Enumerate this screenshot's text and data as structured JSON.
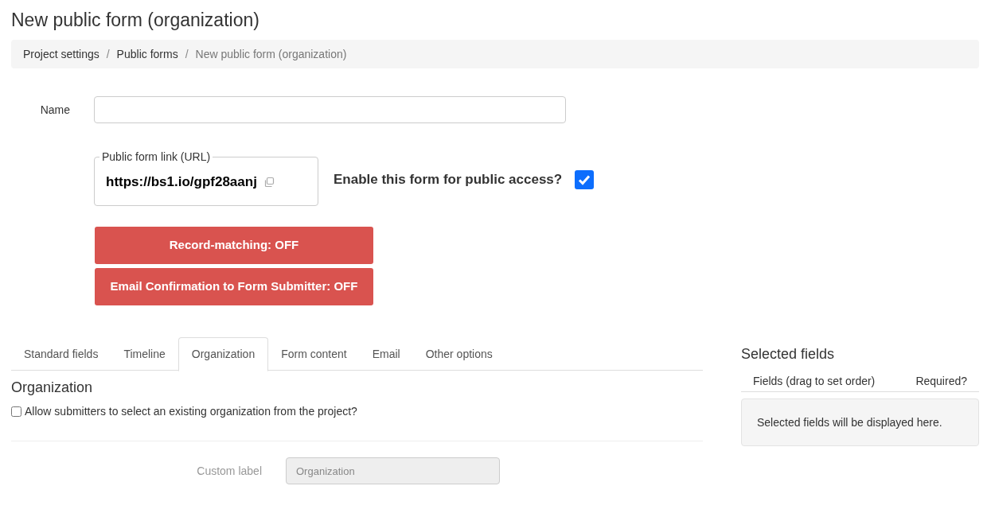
{
  "page_title": "New public form (organization)",
  "breadcrumb_separator": "/",
  "breadcrumb": [
    {
      "label": "Project settings",
      "link": true
    },
    {
      "label": "Public forms",
      "link": true
    },
    {
      "label": "New public form (organization)",
      "link": false
    }
  ],
  "name_field": {
    "label": "Name"
  },
  "public_link": {
    "legend": "Public form link (URL)",
    "url": "https://bs1.io/gpf28aanj"
  },
  "public_access": {
    "label": "Enable this form for public access?",
    "checked": true
  },
  "toggle_buttons": [
    {
      "label": "Record-matching: OFF",
      "on": false
    },
    {
      "label": "Email Confirmation to Form Submitter: OFF",
      "on": false
    }
  ],
  "tabs": [
    {
      "label": "Standard fields",
      "selected": false
    },
    {
      "label": "Timeline",
      "selected": false
    },
    {
      "label": "Organization",
      "selected": true
    },
    {
      "label": "Form content",
      "selected": false
    },
    {
      "label": "Email",
      "selected": false
    },
    {
      "label": "Other options",
      "selected": false
    }
  ],
  "organization": {
    "heading": "Organization",
    "allow_existing": {
      "label": "Allow submitters to select an existing organization from the project?",
      "checked": false
    },
    "custom_label": {
      "label": "Custom label",
      "value": "Organization",
      "disabled": true
    }
  },
  "selected_fields": {
    "heading": "Selected fields",
    "columns": [
      "Fields (drag to set order)",
      "Required?"
    ],
    "empty_message": "Selected fields will be displayed here."
  }
}
